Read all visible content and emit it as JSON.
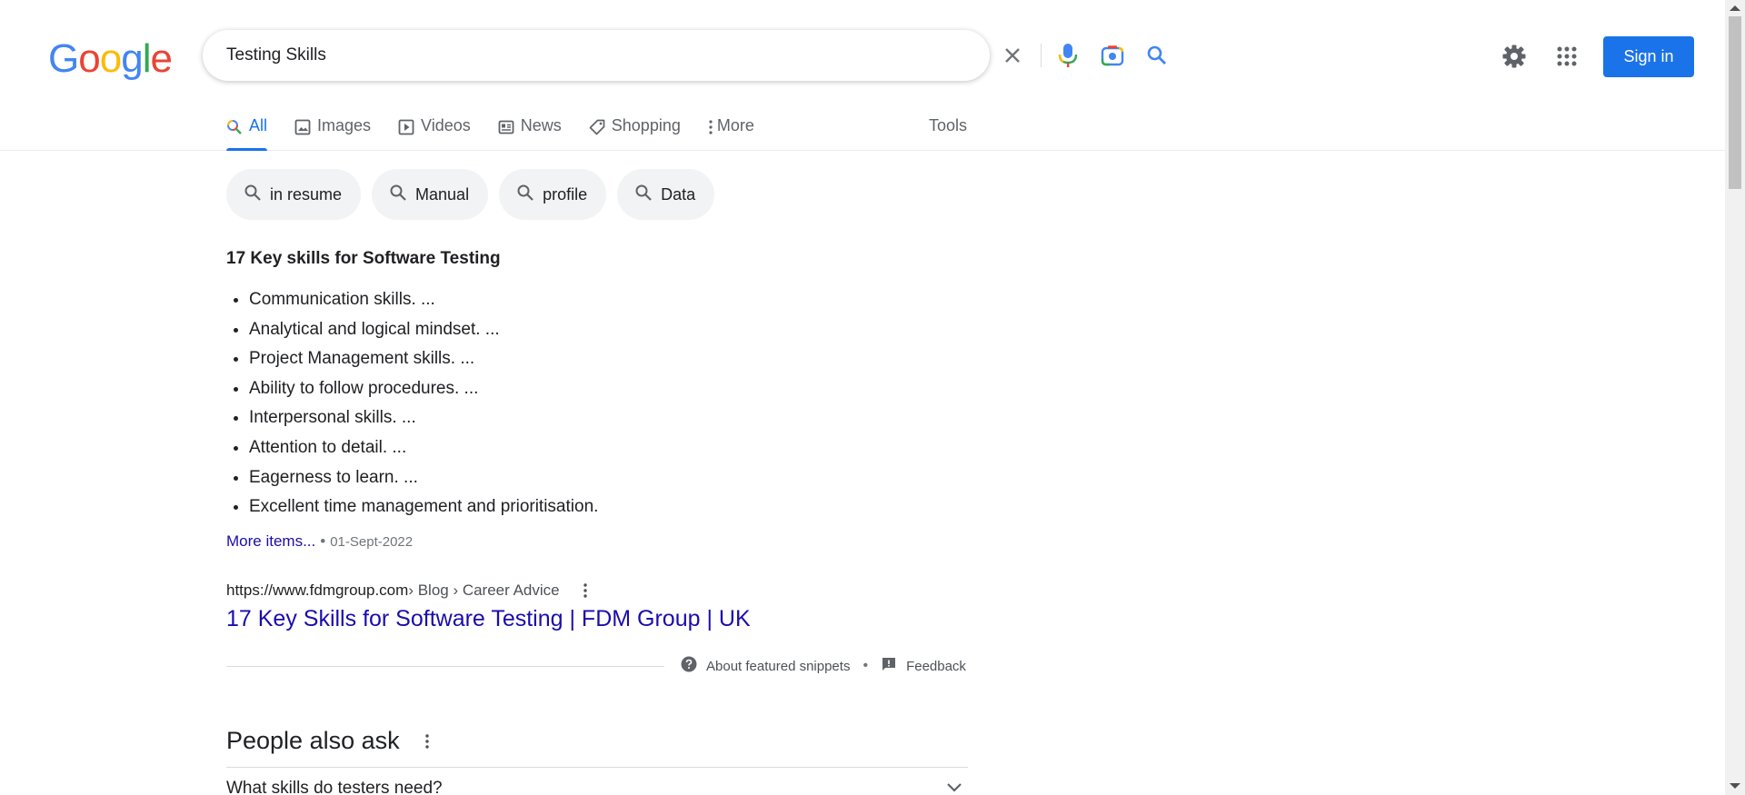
{
  "logo": {
    "letters": [
      "G",
      "o",
      "o",
      "g",
      "l",
      "e"
    ]
  },
  "search": {
    "query": "Testing Skills"
  },
  "header": {
    "signin_label": "Sign in"
  },
  "tabs": [
    {
      "label": "All",
      "icon": "search-icon",
      "active": true
    },
    {
      "label": "Images",
      "icon": "image-icon"
    },
    {
      "label": "Videos",
      "icon": "play-icon"
    },
    {
      "label": "News",
      "icon": "news-icon"
    },
    {
      "label": "Shopping",
      "icon": "tag-icon"
    },
    {
      "label": "More",
      "icon": "more-vert-icon"
    }
  ],
  "tools_label": "Tools",
  "chips": [
    "in resume",
    "Manual",
    "profile",
    "Data"
  ],
  "snippet": {
    "title": "17 Key skills for Software Testing",
    "items": [
      "Communication skills. ...",
      "Analytical and logical mindset. ...",
      "Project Management skills. ...",
      "Ability to follow procedures. ...",
      "Interpersonal skills. ...",
      "Attention to detail. ...",
      "Eagerness to learn. ...",
      "Excellent time management and prioritisation."
    ],
    "more_label": "More items...",
    "date": "01-Sept-2022"
  },
  "result": {
    "cite_host": "https://www.fdmgroup.com",
    "cite_path": " › Blog › Career Advice",
    "title": "17 Key Skills for Software Testing | FDM Group | UK"
  },
  "snippet_footer": {
    "about": "About featured snippets",
    "feedback": "Feedback"
  },
  "paa": {
    "title": "People also ask",
    "question": "What skills do testers need?"
  },
  "colors": {
    "accent": "#1a73e8",
    "link": "#1a0dab"
  }
}
